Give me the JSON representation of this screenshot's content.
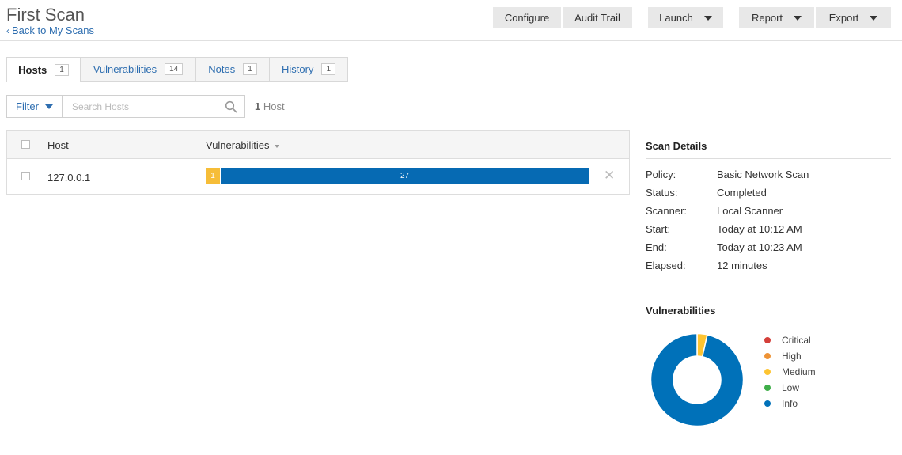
{
  "header": {
    "title": "First Scan",
    "back_link": "Back to My Scans",
    "buttons": {
      "configure": "Configure",
      "audit_trail": "Audit Trail",
      "launch": "Launch",
      "report": "Report",
      "export": "Export"
    }
  },
  "tabs": [
    {
      "label": "Hosts",
      "count": "1",
      "active": true
    },
    {
      "label": "Vulnerabilities",
      "count": "14",
      "active": false
    },
    {
      "label": "Notes",
      "count": "1",
      "active": false
    },
    {
      "label": "History",
      "count": "1",
      "active": false
    }
  ],
  "toolbar": {
    "filter_label": "Filter",
    "search_placeholder": "Search Hosts",
    "host_count_num": "1",
    "host_count_label": "Host"
  },
  "table": {
    "columns": {
      "host": "Host",
      "vulnerabilities": "Vulnerabilities"
    },
    "rows": [
      {
        "host": "127.0.0.1",
        "medium": "1",
        "info": "27"
      }
    ]
  },
  "scan_details": {
    "title": "Scan Details",
    "fields": [
      {
        "label": "Policy:",
        "value": "Basic Network Scan"
      },
      {
        "label": "Status:",
        "value": "Completed"
      },
      {
        "label": "Scanner:",
        "value": "Local Scanner"
      },
      {
        "label": "Start:",
        "value": "Today at 10:12 AM"
      },
      {
        "label": "End:",
        "value": "Today at 10:23 AM"
      },
      {
        "label": "Elapsed:",
        "value": "12 minutes"
      }
    ]
  },
  "vuln_chart": {
    "title": "Vulnerabilities",
    "legend": [
      {
        "label": "Critical",
        "color": "#d43f3a"
      },
      {
        "label": "High",
        "color": "#ee9336"
      },
      {
        "label": "Medium",
        "color": "#fdc431"
      },
      {
        "label": "Low",
        "color": "#3fae49"
      },
      {
        "label": "Info",
        "color": "#0071b9"
      }
    ]
  },
  "chart_data": {
    "type": "pie",
    "categories": [
      "Critical",
      "High",
      "Medium",
      "Low",
      "Info"
    ],
    "values": [
      0,
      0,
      1,
      0,
      27
    ],
    "title": "Vulnerabilities"
  },
  "colors": {
    "link": "#2e6eb0",
    "medium": "#f6bd38",
    "info": "#066ab3"
  },
  "icons": {
    "back": "chevron-left-icon",
    "search": "search-icon",
    "remove": "close-icon",
    "dropdown": "caret-down-icon"
  }
}
